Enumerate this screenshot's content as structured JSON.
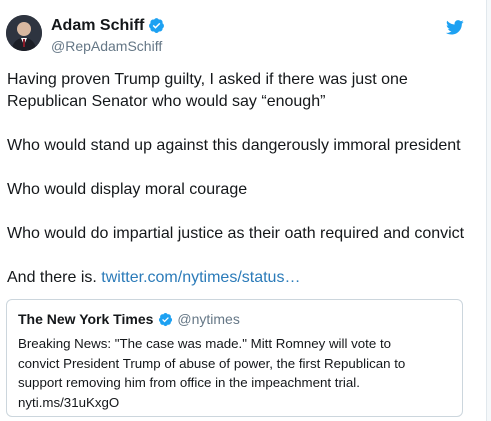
{
  "author": {
    "display_name": "Adam Schiff",
    "handle": "@RepAdamSchiff"
  },
  "icons": {
    "verified": "verified-badge-icon",
    "brand": "twitter-bird-icon"
  },
  "colors": {
    "link": "#2b7bb9",
    "verified": "#1da1f2",
    "secondary_text": "#657786",
    "border": "#ccd6dd"
  },
  "tweet": {
    "paragraphs": [
      "Having proven Trump guilty, I asked if there was just one",
      "Republican Senator who would say “enough”",
      "Who would stand up against this dangerously immoral president",
      "Who would display moral courage",
      "Who would do impartial justice as their oath required and convict",
      "And there is."
    ],
    "link_text": "twitter.com/nytimes/status…"
  },
  "quoted": {
    "display_name": "The New York Times",
    "handle": "@nytimes",
    "lines": [
      "Breaking News: \"The case was made.\" Mitt Romney will vote to",
      "convict President Trump of abuse of power, the first Republican to",
      "support removing him from office in the impeachment trial.",
      "nyti.ms/31uKxgO"
    ]
  }
}
